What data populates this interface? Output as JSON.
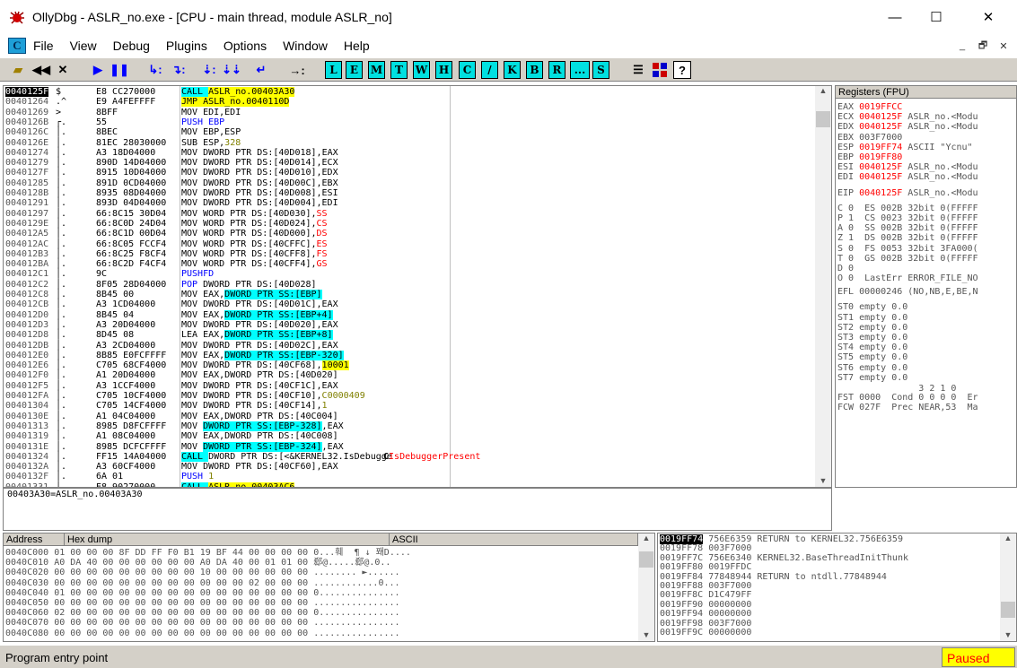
{
  "window": {
    "title": "OllyDbg - ASLR_no.exe - [CPU - main thread, module ASLR_no]",
    "minimize": "—",
    "maximize": "☐",
    "close": "✕"
  },
  "menu": [
    "File",
    "View",
    "Debug",
    "Plugins",
    "Options",
    "Window",
    "Help"
  ],
  "mdi_icon_label": "C",
  "mdi_controls": [
    "_",
    "🗗",
    "✕"
  ],
  "toolbar": {
    "icons": [
      "open-icon",
      "rewind-icon",
      "close-process-icon",
      "run-icon",
      "pause-icon",
      "step-into-icon",
      "step-over-icon",
      "trace-into-icon",
      "trace-over-icon",
      "execute-till-return-icon",
      "go-to-icon"
    ],
    "letters": [
      "L",
      "E",
      "M",
      "T",
      "W",
      "H",
      "C",
      "/",
      "K",
      "B",
      "R",
      "...",
      "S"
    ],
    "extra_icons": [
      "list-icon",
      "grid-icon",
      "help-icon"
    ]
  },
  "cpu": {
    "rows": [
      {
        "addr": "0040125F",
        "mark": "$",
        "hex": "E8 CC270000",
        "dis": [
          [
            "CALL ",
            "hl-cyan"
          ],
          [
            "ASLR_no.00403A30",
            "hl-yel"
          ]
        ],
        "com": "",
        "sel": true
      },
      {
        "addr": "00401264",
        "mark": ".^",
        "hex": "E9 A4FEFFFF",
        "dis": [
          [
            "JMP ",
            "hl-yel"
          ],
          [
            "ASLR_no.0040110D",
            "hl-yel"
          ]
        ],
        "com": ""
      },
      {
        "addr": "00401269",
        "mark": ">",
        "hex": "8BFF",
        "dis": [
          [
            "MOV EDI,EDI",
            ""
          ]
        ],
        "com": ""
      },
      {
        "addr": "0040126B",
        "mark": "┌.",
        "hex": "55",
        "dis": [
          [
            "PUSH EBP",
            "kw-blue"
          ]
        ],
        "com": ""
      },
      {
        "addr": "0040126C",
        "mark": "│.",
        "hex": "8BEC",
        "dis": [
          [
            "MOV EBP,ESP",
            ""
          ]
        ],
        "com": ""
      },
      {
        "addr": "0040126E",
        "mark": "│.",
        "hex": "81EC 28030000",
        "dis": [
          [
            "SUB ESP,",
            ""
          ],
          [
            "328",
            "kw-olive"
          ]
        ],
        "com": ""
      },
      {
        "addr": "00401274",
        "mark": "│.",
        "hex": "A3 18D04000",
        "dis": [
          [
            "MOV ",
            ""
          ],
          [
            "DWORD PTR DS:",
            ""
          ],
          [
            "[40D018]",
            ""
          ],
          [
            ",EAX",
            ""
          ]
        ],
        "com": ""
      },
      {
        "addr": "00401279",
        "mark": "│.",
        "hex": "890D 14D04000",
        "dis": [
          [
            "MOV DWORD PTR DS:[40D014],ECX",
            ""
          ]
        ],
        "com": ""
      },
      {
        "addr": "0040127F",
        "mark": "│.",
        "hex": "8915 10D04000",
        "dis": [
          [
            "MOV DWORD PTR DS:[40D010],EDX",
            ""
          ]
        ],
        "com": ""
      },
      {
        "addr": "00401285",
        "mark": "│.",
        "hex": "891D 0CD04000",
        "dis": [
          [
            "MOV DWORD PTR DS:[40D00C],EBX",
            ""
          ]
        ],
        "com": ""
      },
      {
        "addr": "0040128B",
        "mark": "│.",
        "hex": "8935 08D04000",
        "dis": [
          [
            "MOV DWORD PTR DS:[40D008],ESI",
            ""
          ]
        ],
        "com": ""
      },
      {
        "addr": "00401291",
        "mark": "│.",
        "hex": "893D 04D04000",
        "dis": [
          [
            "MOV DWORD PTR DS:[40D004],EDI",
            ""
          ]
        ],
        "com": ""
      },
      {
        "addr": "00401297",
        "mark": "│.",
        "hex": "66:8C15 30D04",
        "dis": [
          [
            "MOV WORD PTR DS:[40D030],",
            ""
          ],
          [
            "SS",
            "kw-red"
          ]
        ],
        "com": ""
      },
      {
        "addr": "0040129E",
        "mark": "│.",
        "hex": "66:8C0D 24D04",
        "dis": [
          [
            "MOV WORD PTR DS:[40D024],",
            ""
          ],
          [
            "CS",
            "kw-red"
          ]
        ],
        "com": ""
      },
      {
        "addr": "004012A5",
        "mark": "│.",
        "hex": "66:8C1D 00D04",
        "dis": [
          [
            "MOV WORD PTR DS:[40D000],",
            ""
          ],
          [
            "DS",
            "kw-red"
          ]
        ],
        "com": ""
      },
      {
        "addr": "004012AC",
        "mark": "│.",
        "hex": "66:8C05 FCCF4",
        "dis": [
          [
            "MOV WORD PTR DS:[40CFFC],",
            ""
          ],
          [
            "ES",
            "kw-red"
          ]
        ],
        "com": ""
      },
      {
        "addr": "004012B3",
        "mark": "│.",
        "hex": "66:8C25 F8CF4",
        "dis": [
          [
            "MOV WORD PTR DS:[40CFF8],",
            ""
          ],
          [
            "FS",
            "kw-red"
          ]
        ],
        "com": ""
      },
      {
        "addr": "004012BA",
        "mark": "│.",
        "hex": "66:8C2D F4CF4",
        "dis": [
          [
            "MOV WORD PTR DS:[40CFF4],",
            ""
          ],
          [
            "GS",
            "kw-red"
          ]
        ],
        "com": ""
      },
      {
        "addr": "004012C1",
        "mark": "│.",
        "hex": "9C",
        "dis": [
          [
            "PUSHFD",
            "kw-blue"
          ]
        ],
        "com": ""
      },
      {
        "addr": "004012C2",
        "mark": "│.",
        "hex": "8F05 28D04000",
        "dis": [
          [
            "POP ",
            "kw-blue"
          ],
          [
            "DWORD PTR DS:[40D028]",
            ""
          ]
        ],
        "com": ""
      },
      {
        "addr": "004012C8",
        "mark": "│.",
        "hex": "8B45 00",
        "dis": [
          [
            "MOV EAX,",
            ""
          ],
          [
            "DWORD PTR SS:[EBP]",
            "hl-cyan"
          ]
        ],
        "com": ""
      },
      {
        "addr": "004012CB",
        "mark": "│.",
        "hex": "A3 1CD04000",
        "dis": [
          [
            "MOV DWORD PTR DS:[40D01C],EAX",
            ""
          ]
        ],
        "com": ""
      },
      {
        "addr": "004012D0",
        "mark": "│.",
        "hex": "8B45 04",
        "dis": [
          [
            "MOV EAX,",
            ""
          ],
          [
            "DWORD PTR SS:[EBP+4]",
            "hl-cyan"
          ]
        ],
        "com": ""
      },
      {
        "addr": "004012D3",
        "mark": "│.",
        "hex": "A3 20D04000",
        "dis": [
          [
            "MOV DWORD PTR DS:[40D020],EAX",
            ""
          ]
        ],
        "com": ""
      },
      {
        "addr": "004012D8",
        "mark": "│.",
        "hex": "8D45 08",
        "dis": [
          [
            "LEA EAX,",
            ""
          ],
          [
            "DWORD PTR SS:[EBP+8]",
            "hl-cyan"
          ]
        ],
        "com": ""
      },
      {
        "addr": "004012DB",
        "mark": "│.",
        "hex": "A3 2CD04000",
        "dis": [
          [
            "MOV DWORD PTR DS:[40D02C],EAX",
            ""
          ]
        ],
        "com": ""
      },
      {
        "addr": "004012E0",
        "mark": "│.",
        "hex": "8B85 E0FCFFFF",
        "dis": [
          [
            "MOV EAX,",
            ""
          ],
          [
            "DWORD PTR SS:[EBP-320]",
            "hl-cyan"
          ]
        ],
        "com": ""
      },
      {
        "addr": "004012E6",
        "mark": "│.",
        "hex": "C705 68CF4000",
        "dis": [
          [
            "MOV DWORD PTR DS:[40CF68],",
            ""
          ],
          [
            "10001",
            "hl-yel"
          ]
        ],
        "com": ""
      },
      {
        "addr": "004012F0",
        "mark": "│.",
        "hex": "A1 20D04000",
        "dis": [
          [
            "MOV EAX,DWORD PTR DS:[40D020]",
            ""
          ]
        ],
        "com": ""
      },
      {
        "addr": "004012F5",
        "mark": "│.",
        "hex": "A3 1CCF4000",
        "dis": [
          [
            "MOV DWORD PTR DS:[40CF1C],EAX",
            ""
          ]
        ],
        "com": ""
      },
      {
        "addr": "004012FA",
        "mark": "│.",
        "hex": "C705 10CF4000",
        "dis": [
          [
            "MOV DWORD PTR DS:[40CF10],",
            ""
          ],
          [
            "C0000409",
            "kw-olive"
          ]
        ],
        "com": ""
      },
      {
        "addr": "00401304",
        "mark": "│.",
        "hex": "C705 14CF4000",
        "dis": [
          [
            "MOV DWORD PTR DS:[40CF14],",
            ""
          ],
          [
            "1",
            "kw-olive"
          ]
        ],
        "com": ""
      },
      {
        "addr": "0040130E",
        "mark": "│.",
        "hex": "A1 04C04000",
        "dis": [
          [
            "MOV EAX,DWORD PTR DS:[40C004]",
            ""
          ]
        ],
        "com": ""
      },
      {
        "addr": "00401313",
        "mark": "│.",
        "hex": "8985 D8FCFFFF",
        "dis": [
          [
            "MOV ",
            ""
          ],
          [
            "DWORD PTR SS:[EBP-328]",
            "hl-cyan"
          ],
          [
            ",EAX",
            ""
          ]
        ],
        "com": ""
      },
      {
        "addr": "00401319",
        "mark": "│.",
        "hex": "A1 08C04000",
        "dis": [
          [
            "MOV EAX,DWORD PTR DS:[40C008]",
            ""
          ]
        ],
        "com": ""
      },
      {
        "addr": "0040131E",
        "mark": "│.",
        "hex": "8985 DCFCFFFF",
        "dis": [
          [
            "MOV ",
            ""
          ],
          [
            "DWORD PTR SS:[EBP-324]",
            "hl-cyan"
          ],
          [
            ",EAX",
            ""
          ]
        ],
        "com": ""
      },
      {
        "addr": "00401324",
        "mark": "│.",
        "hex": "FF15 14A04000",
        "dis": [
          [
            "CALL ",
            "hl-cyan"
          ],
          [
            "DWORD PTR DS:[<&KERNEL32.IsDebugge",
            ""
          ]
        ],
        "com": "IsDebuggerPresent"
      },
      {
        "addr": "0040132A",
        "mark": "│.",
        "hex": "A3 60CF4000",
        "dis": [
          [
            "MOV DWORD PTR DS:[40CF60],EAX",
            ""
          ]
        ],
        "com": ""
      },
      {
        "addr": "0040132F",
        "mark": "│.",
        "hex": "6A 01",
        "dis": [
          [
            "PUSH ",
            "kw-blue"
          ],
          [
            "1",
            "kw-olive"
          ]
        ],
        "com": ""
      },
      {
        "addr": "00401331",
        "mark": "│.",
        "hex": "E8 90270000",
        "dis": [
          [
            "CALL ",
            "hl-cyan"
          ],
          [
            "ASLR_no.00403AC6",
            "hl-yel"
          ]
        ],
        "com": ""
      }
    ],
    "info": "00403A30=ASLR_no.00403A30"
  },
  "registers": {
    "header": "Registers (FPU)",
    "rows": [
      [
        "EAX",
        "0019FFCC",
        "",
        true
      ],
      [
        "ECX",
        "0040125F",
        "ASLR_no.<Modu",
        true
      ],
      [
        "EDX",
        "0040125F",
        "ASLR_no.<Modu",
        true
      ],
      [
        "EBX",
        "003F7000",
        "",
        false
      ],
      [
        "ESP",
        "0019FF74",
        "ASCII \"Ycnu\"",
        true
      ],
      [
        "EBP",
        "0019FF80",
        "",
        true
      ],
      [
        "ESI",
        "0040125F",
        "ASLR_no.<Modu",
        true
      ],
      [
        "EDI",
        "0040125F",
        "ASLR_no.<Modu",
        true
      ],
      [
        "",
        "",
        " ",
        false
      ],
      [
        "EIP",
        "0040125F",
        "ASLR_no.<Modu",
        true
      ]
    ],
    "flags": [
      "C 0  ES 002B 32bit 0(FFFFF",
      "P 1  CS 0023 32bit 0(FFFFF",
      "A 0  SS 002B 32bit 0(FFFFF",
      "Z 1  DS 002B 32bit 0(FFFFF",
      "S 0  FS 0053 32bit 3FA000(",
      "T 0  GS 002B 32bit 0(FFFFF",
      "D 0",
      "O 0  LastErr ERROR_FILE_NO"
    ],
    "efl": "EFL 00000246 (NO,NB,E,BE,N",
    "fpu": [
      "ST0 empty 0.0",
      "ST1 empty 0.0",
      "ST2 empty 0.0",
      "ST3 empty 0.0",
      "ST4 empty 0.0",
      "ST5 empty 0.0",
      "ST6 empty 0.0",
      "ST7 empty 0.0"
    ],
    "fpu_bits": "               3 2 1 0",
    "fst": "FST 0000  Cond 0 0 0 0  Er",
    "fcw": "FCW 027F  Prec NEAR,53  Ma"
  },
  "dump": {
    "hdr_address": "Address",
    "hdr_hex": "Hex dump",
    "hdr_ascii": "ASCII",
    "rows": [
      [
        "0040C000",
        "01 00 00 00 8F DD FF F0 B1 19 BF 44 00 00 00 00",
        "0...훼  ¶ ↓ 퐤D...."
      ],
      [
        "0040C010",
        "A0 DA 40 00 00 00 00 00 00 A0 DA 40 00 01 01 00",
        "郄@.....郄@.0.."
      ],
      [
        "0040C020",
        "00 00 00 00 00 00 00 00 00 10 00 00 00 00 00 00",
        "........ ►......"
      ],
      [
        "0040C030",
        "00 00 00 00 00 00 00 00 00 00 00 00 02 00 00 00",
        "............0..."
      ],
      [
        "0040C040",
        "01 00 00 00 00 00 00 00 00 00 00 00 00 00 00 00",
        "0..............."
      ],
      [
        "0040C050",
        "00 00 00 00 00 00 00 00 00 00 00 00 00 00 00 00",
        "................"
      ],
      [
        "0040C060",
        "02 00 00 00 00 00 00 00 00 00 00 00 00 00 00 00",
        "0..............."
      ],
      [
        "0040C070",
        "00 00 00 00 00 00 00 00 00 00 00 00 00 00 00 00",
        "................"
      ],
      [
        "0040C080",
        "00 00 00 00 00 00 00 00 00 00 00 00 00 00 00 00",
        "................"
      ]
    ]
  },
  "stack": {
    "rows": [
      [
        "0019FF74",
        "756E6359",
        "RETURN to KERNEL32.756E6359",
        true
      ],
      [
        "0019FF78",
        "003F7000",
        "",
        false
      ],
      [
        "0019FF7C",
        "756E6340",
        "KERNEL32.BaseThreadInitThunk",
        false
      ],
      [
        "0019FF80",
        "0019FFDC",
        "",
        false
      ],
      [
        "0019FF84",
        "77848944",
        "RETURN to ntdll.77848944",
        false
      ],
      [
        "0019FF88",
        "003F7000",
        "",
        false
      ],
      [
        "0019FF8C",
        "D1C479FF",
        "",
        false
      ],
      [
        "0019FF90",
        "00000000",
        "",
        false
      ],
      [
        "0019FF94",
        "00000000",
        "",
        false
      ],
      [
        "0019FF98",
        "003F7000",
        "",
        false
      ],
      [
        "0019FF9C",
        "00000000",
        "",
        false
      ]
    ]
  },
  "status": {
    "text": "Program entry point",
    "state": "Paused"
  }
}
